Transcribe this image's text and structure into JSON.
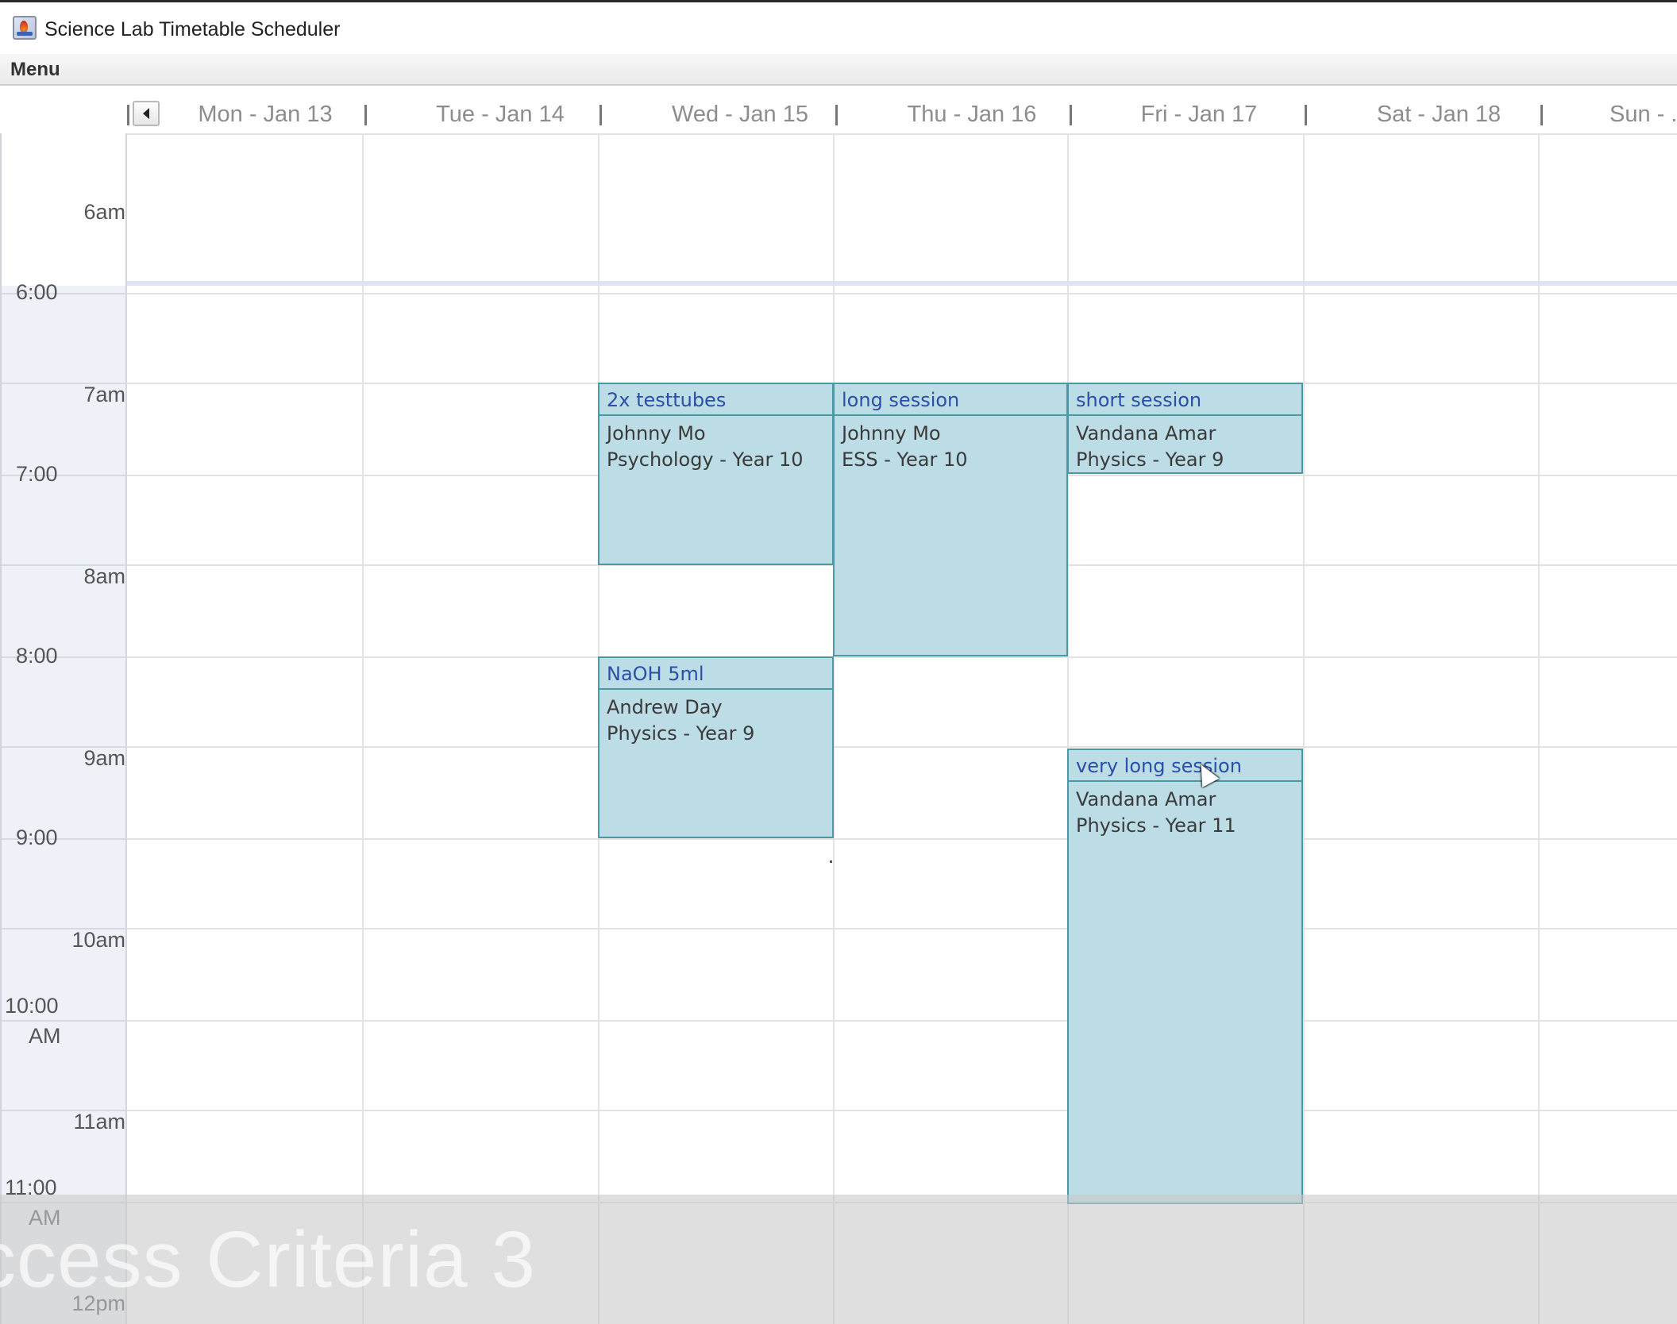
{
  "window": {
    "title": "Science Lab Timetable Scheduler",
    "icon": "java-app-icon"
  },
  "menubar": {
    "items": [
      "Menu"
    ]
  },
  "calendar": {
    "nav_prev_icon": "triangle-left-icon",
    "days": [
      "Mon - Jan 13",
      "Tue - Jan 14",
      "Wed - Jan 15",
      "Thu - Jan 16",
      "Fri - Jan 17",
      "Sat - Jan 18",
      "Sun - ."
    ],
    "time_labels": [
      {
        "hour": "6am",
        "half": "6:00",
        "half_suffix": ""
      },
      {
        "hour": "7am",
        "half": "7:00",
        "half_suffix": ""
      },
      {
        "hour": "8am",
        "half": "8:00",
        "half_suffix": ""
      },
      {
        "hour": "9am",
        "half": "9:00",
        "half_suffix": ""
      },
      {
        "hour": "10am",
        "half": "10:00",
        "half_suffix": "AM"
      },
      {
        "hour": "11am",
        "half": "11:00",
        "half_suffix": "AM"
      },
      {
        "hour": "12pm",
        "half": "",
        "half_suffix": ""
      }
    ],
    "events": [
      {
        "title": "2x testtubes",
        "teacher": "Johnny Mo",
        "class": "Psychology - Year 10",
        "day": "Wed - Jan 15"
      },
      {
        "title": "long session",
        "teacher": "Johnny Mo",
        "class": "ESS - Year 10",
        "day": "Thu - Jan 16"
      },
      {
        "title": "short session",
        "teacher": "Vandana Amar",
        "class": "Physics - Year 9",
        "day": "Fri - Jan 17"
      },
      {
        "title": "NaOH 5ml",
        "teacher": "Andrew Day",
        "class": "Physics - Year 9",
        "day": "Wed - Jan 15"
      },
      {
        "title": "very long session",
        "teacher": "Vandana Amar",
        "class": "Physics - Year 11",
        "day": "Fri - Jan 17"
      }
    ],
    "colors": {
      "event_fill": "#bcdde5",
      "event_border": "#4a9aa6",
      "event_title": "#2a4fa8",
      "gutter": "#eef2f8"
    }
  },
  "overlay": {
    "text": "ccess Criteria 3"
  }
}
